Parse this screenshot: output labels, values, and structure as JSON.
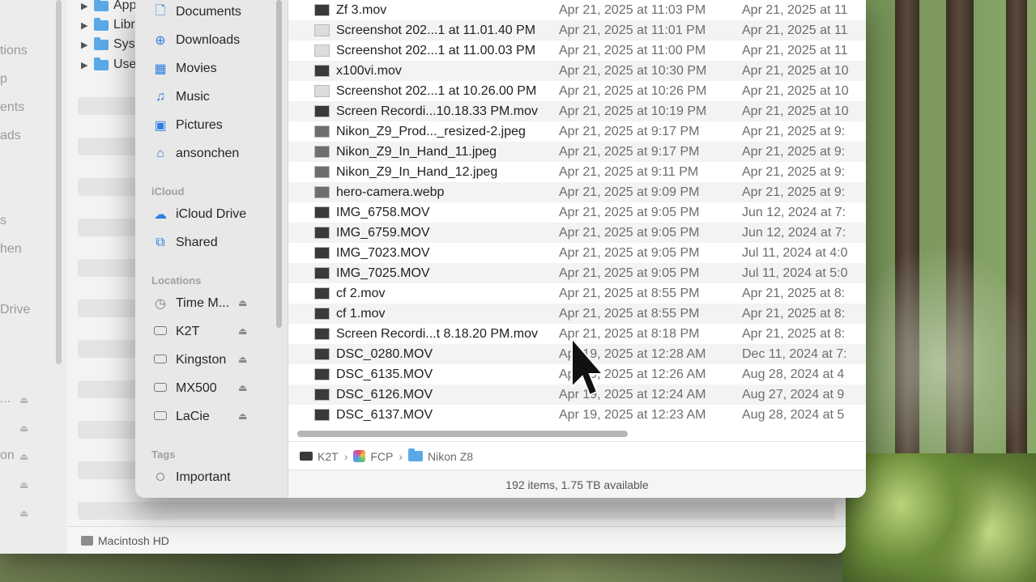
{
  "back_window": {
    "sidebar_labels": [
      "tions",
      "p",
      "ents",
      "ads",
      "s",
      "hen",
      "Drive",
      "...",
      "on"
    ],
    "tree_items": [
      "App",
      "Libr",
      "Sys",
      "Use"
    ],
    "path_label": "Macintosh HD"
  },
  "sidebar": {
    "favorites": [
      {
        "label": "Documents",
        "icon": "document-icon"
      },
      {
        "label": "Downloads",
        "icon": "download-icon"
      },
      {
        "label": "Movies",
        "icon": "film-icon"
      },
      {
        "label": "Music",
        "icon": "music-note-icon"
      },
      {
        "label": "Pictures",
        "icon": "photo-icon"
      },
      {
        "label": "ansonchen",
        "icon": "home-icon"
      }
    ],
    "icloud_header": "iCloud",
    "icloud": [
      {
        "label": "iCloud Drive",
        "icon": "cloud-icon"
      },
      {
        "label": "Shared",
        "icon": "shared-folder-icon"
      }
    ],
    "locations_header": "Locations",
    "locations": [
      {
        "label": "Time M...",
        "icon": "time-machine-icon"
      },
      {
        "label": "K2T",
        "icon": "drive-icon"
      },
      {
        "label": "Kingston",
        "icon": "drive-icon"
      },
      {
        "label": "MX500",
        "icon": "drive-icon"
      },
      {
        "label": "LaCie",
        "icon": "drive-icon"
      }
    ],
    "tags_header": "Tags",
    "tags": [
      {
        "label": "Important",
        "icon": "tag-circle-icon"
      }
    ]
  },
  "files": [
    {
      "name": "Zf 3.mov",
      "modified": "Apr 21, 2025 at 11:03 PM",
      "created": "Apr 21, 2025 at 11"
    },
    {
      "name": "Screenshot 202...1 at 11.01.40 PM",
      "modified": "Apr 21, 2025 at 11:01 PM",
      "created": "Apr 21, 2025 at 11"
    },
    {
      "name": "Screenshot 202...1 at 11.00.03 PM",
      "modified": "Apr 21, 2025 at 11:00 PM",
      "created": "Apr 21, 2025 at 11"
    },
    {
      "name": "x100vi.mov",
      "modified": "Apr 21, 2025 at 10:30 PM",
      "created": "Apr 21, 2025 at 10"
    },
    {
      "name": "Screenshot 202...1 at 10.26.00 PM",
      "modified": "Apr 21, 2025 at 10:26 PM",
      "created": "Apr 21, 2025 at 10"
    },
    {
      "name": "Screen Recordi...10.18.33 PM.mov",
      "modified": "Apr 21, 2025 at 10:19 PM",
      "created": "Apr 21, 2025 at 10"
    },
    {
      "name": "Nikon_Z9_Prod..._resized-2.jpeg",
      "modified": "Apr 21, 2025 at 9:17 PM",
      "created": "Apr 21, 2025 at 9:"
    },
    {
      "name": "Nikon_Z9_In_Hand_11.jpeg",
      "modified": "Apr 21, 2025 at 9:17 PM",
      "created": "Apr 21, 2025 at 9:"
    },
    {
      "name": "Nikon_Z9_In_Hand_12.jpeg",
      "modified": "Apr 21, 2025 at 9:11 PM",
      "created": "Apr 21, 2025 at 9:"
    },
    {
      "name": "hero-camera.webp",
      "modified": "Apr 21, 2025 at 9:09 PM",
      "created": "Apr 21, 2025 at 9:"
    },
    {
      "name": "IMG_6758.MOV",
      "modified": "Apr 21, 2025 at 9:05 PM",
      "created": "Jun 12, 2024 at 7:"
    },
    {
      "name": "IMG_6759.MOV",
      "modified": "Apr 21, 2025 at 9:05 PM",
      "created": "Jun 12, 2024 at 7:"
    },
    {
      "name": "IMG_7023.MOV",
      "modified": "Apr 21, 2025 at 9:05 PM",
      "created": "Jul 11, 2024 at 4:0"
    },
    {
      "name": "IMG_7025.MOV",
      "modified": "Apr 21, 2025 at 9:05 PM",
      "created": "Jul 11, 2024 at 5:0"
    },
    {
      "name": "cf 2.mov",
      "modified": "Apr 21, 2025 at 8:55 PM",
      "created": "Apr 21, 2025 at 8:"
    },
    {
      "name": "cf 1.mov",
      "modified": "Apr 21, 2025 at 8:55 PM",
      "created": "Apr 21, 2025 at 8:"
    },
    {
      "name": "Screen Recordi...t 8.18.20 PM.mov",
      "modified": "Apr 21, 2025 at 8:18 PM",
      "created": "Apr 21, 2025 at 8:"
    },
    {
      "name": "DSC_0280.MOV",
      "modified": "Apr 19, 2025 at 12:28 AM",
      "created": "Dec 11, 2024 at 7:"
    },
    {
      "name": "DSC_6135.MOV",
      "modified": "Apr 19, 2025 at 12:26 AM",
      "created": "Aug 28, 2024 at 4"
    },
    {
      "name": "DSC_6126.MOV",
      "modified": "Apr 19, 2025 at 12:24 AM",
      "created": "Aug 27, 2024 at 9"
    },
    {
      "name": "DSC_6137.MOV",
      "modified": "Apr 19, 2025 at 12:23 AM",
      "created": "Aug 28, 2024 at 5"
    }
  ],
  "path": [
    "K2T",
    "FCP",
    "Nikon Z8"
  ],
  "status": "192 items, 1.75 TB available"
}
